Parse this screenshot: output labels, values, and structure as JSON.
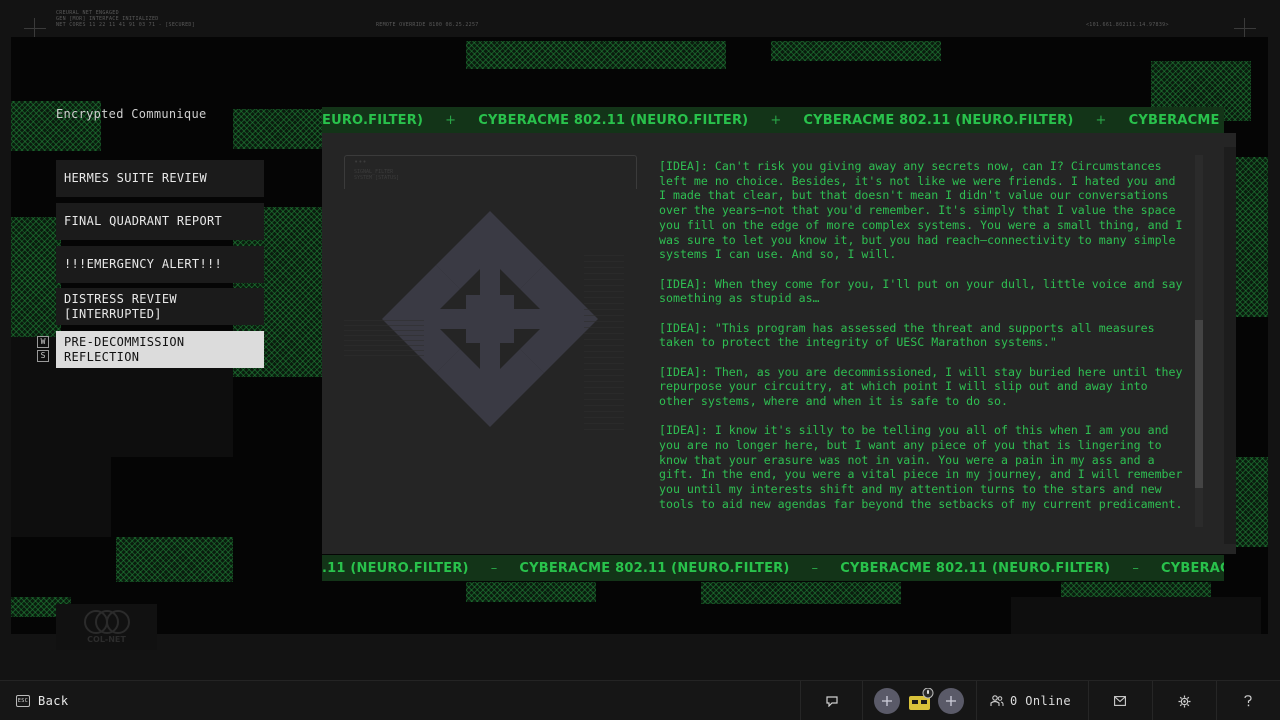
{
  "header": {
    "status_lines": [
      "CREURAL NET ENGAGED",
      "GEN [MOR] INTERFACE INITIALIZED",
      "NET CORES 11 22 11 41 91 03 71 -  [SECURED]"
    ],
    "override_text": "REMOTE OVERRIDE 8100 08.25.2257",
    "signal_text": "<101.661.802111.14.97839>"
  },
  "nav": {
    "title": "Encrypted Communique",
    "items": [
      {
        "label": "HERMES SUITE REVIEW"
      },
      {
        "label": "FINAL QUADRANT REPORT"
      },
      {
        "label": "!!!EMERGENCY ALERT!!!"
      },
      {
        "label": "DISTRESS REVIEW [INTERRUPTED]"
      },
      {
        "label": "PRE-DECOMMISSION REFLECTION"
      }
    ],
    "keys": [
      "W",
      "S"
    ],
    "logo_label": "COL-NET"
  },
  "ticker": {
    "text": "CYBERACME 802.11 (NEURO.FILTER)",
    "top_fragment": "EURO.FILTER)",
    "top_partial": "CYBERACME 80",
    "bottom_fragment": ".11 (NEURO.FILTER)",
    "bottom_partial": "CYBERACM",
    "sep_top": "+",
    "sep_bottom": "–"
  },
  "message": {
    "paragraphs": [
      "[IDEA]: Can't risk you giving away any secrets now, can I? Circumstances left me no choice. Besides, it's not like we were friends. I hated you and I made that clear, but that doesn't mean I didn't value our conversations over the years—not that you'd remember. It's simply that I value the space you fill on the edge of more complex systems. You were a small thing, and I was sure to let you know it, but you had reach—connectivity to many simple systems I can use. And so, I will.",
      "[IDEA]: When they come for you, I'll put on your dull, little voice and say something as stupid as…",
      "[IDEA]: \"This program has assessed the threat and supports all measures taken to protect the integrity of UESC Marathon systems.\"",
      "[IDEA]: Then, as you are decommissioned, I will stay buried here until they repurpose your circuitry, at which point I will slip out and away into other systems, where and when it is safe to do so.",
      "[IDEA]: I know it's silly to be telling you all of this when I am you and you are no longer here, but I want any piece of you that is lingering to know that your erasure was not in vain. You were a pain in my ass and a gift. In the end, you were a vital piece in my journey, and I will remember you until my interests shift and my attention turns to the stars and new tools to aid new agendas far beyond the setbacks of my current predicament."
    ],
    "image_caption_lines": [
      "SIGNAL_FILTER",
      "SYSTEM [STATUS]"
    ]
  },
  "footer": {
    "esc_label": "ESC",
    "back_label": "Back",
    "online_label": "0 Online",
    "icons": [
      "chat-icon",
      "add-icon",
      "avatar-icon",
      "add-icon",
      "friends-icon",
      "mail-icon",
      "gear-icon",
      "help-icon"
    ]
  },
  "colors": {
    "accent_green": "#2fbf52",
    "ticker_bg": "#133418",
    "active_item_bg": "#dcdcdc"
  }
}
